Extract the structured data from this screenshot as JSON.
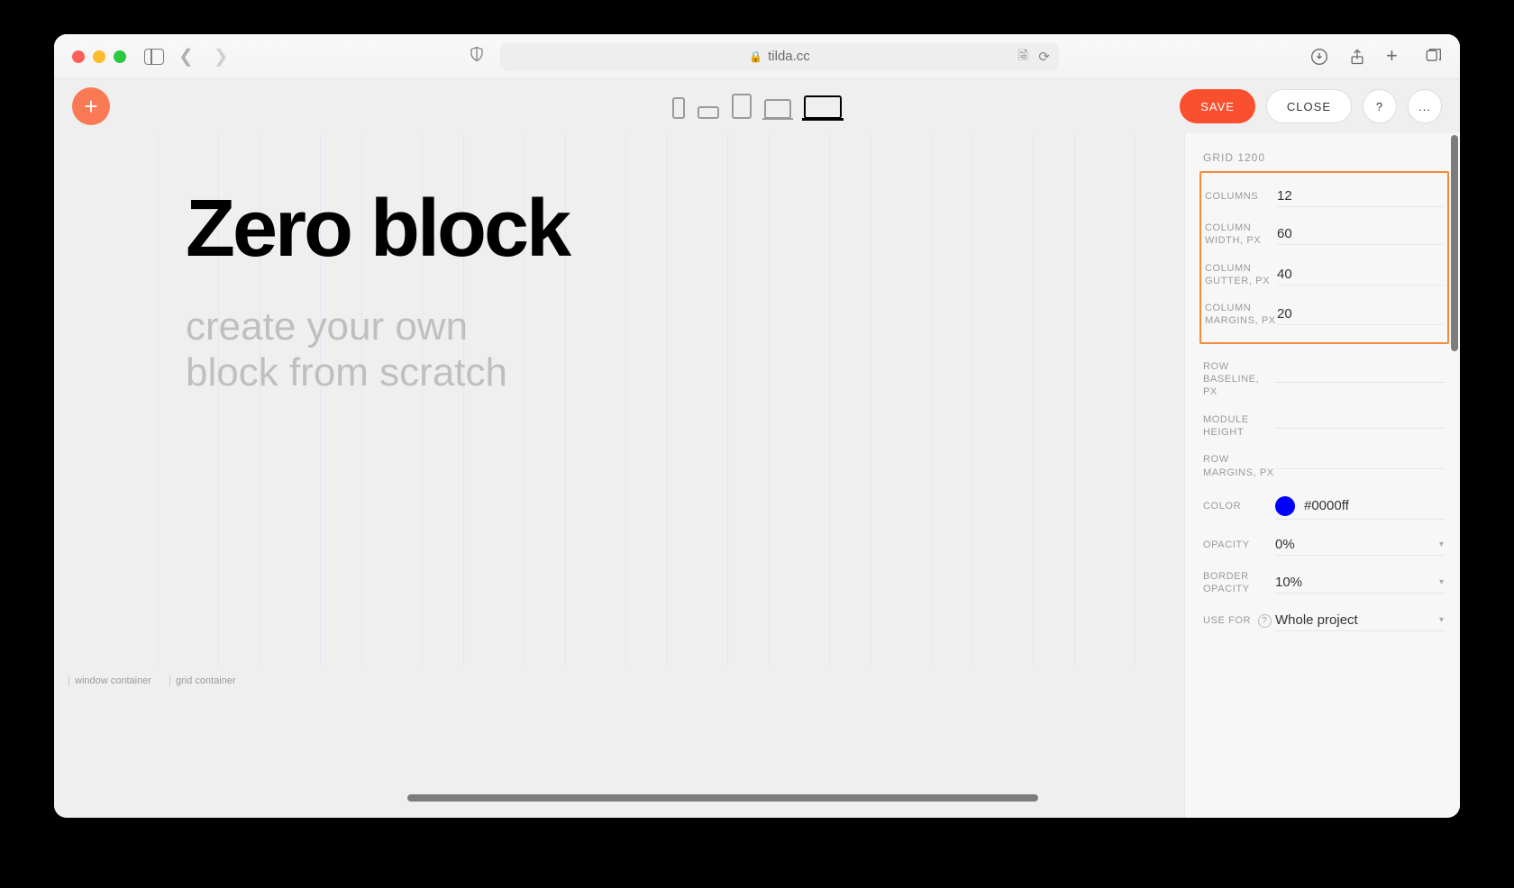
{
  "browser": {
    "url_host": "tilda.cc"
  },
  "toolbar": {
    "save": "SAVE",
    "close": "CLOSE",
    "help": "?",
    "more": "..."
  },
  "canvas": {
    "heading": "Zero block",
    "subheading_l1": "create your own",
    "subheading_l2": "block from scratch",
    "footer_window": "window container",
    "footer_grid": "grid container"
  },
  "panel": {
    "title": "GRID 1200",
    "columns_label": "COLUMNS",
    "columns_value": "12",
    "col_width_label": "COLUMN WIDTH, PX",
    "col_width_value": "60",
    "col_gutter_label": "COLUMN GUTTER, PX",
    "col_gutter_value": "40",
    "col_margins_label": "COLUMN MARGINS, PX",
    "col_margins_value": "20",
    "row_baseline_label": "ROW BASELINE, PX",
    "row_baseline_value": "",
    "module_height_label": "MODULE HEIGHT",
    "module_height_value": "",
    "row_margins_label": "ROW MARGINS, PX",
    "row_margins_value": "",
    "color_label": "COLOR",
    "color_value": "#0000ff",
    "opacity_label": "OPACITY",
    "opacity_value": "0%",
    "border_opacity_label": "BORDER OPACITY",
    "border_opacity_value": "10%",
    "use_for_label": "USE FOR",
    "use_for_value": "Whole project"
  }
}
